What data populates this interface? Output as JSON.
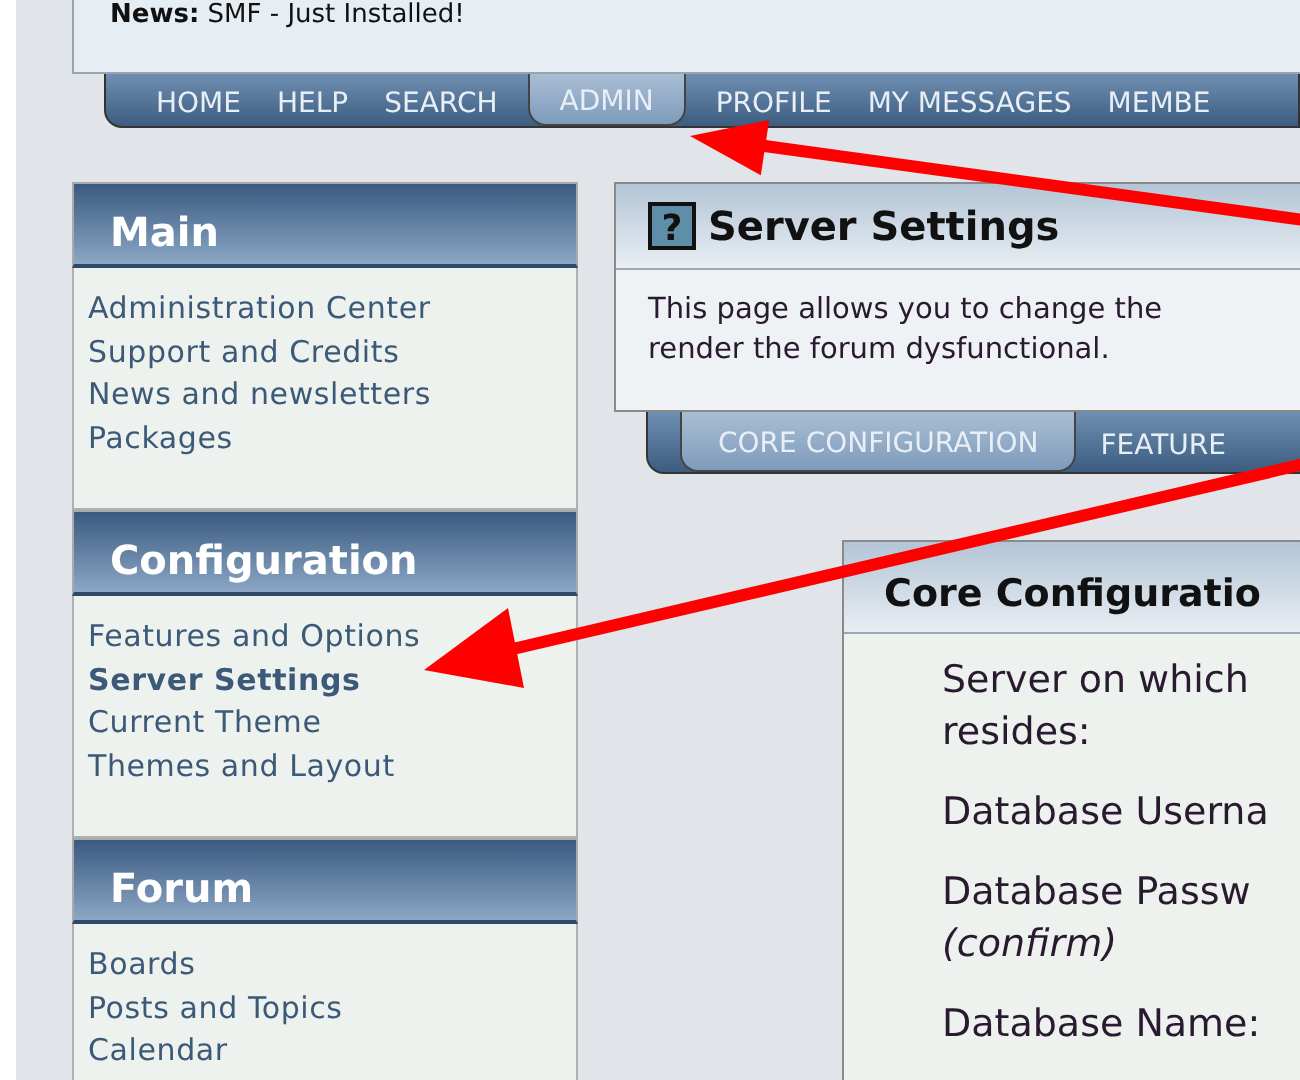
{
  "news": {
    "label": "News:",
    "text": "SMF - Just Installed!"
  },
  "menu": [
    {
      "label": "HOME",
      "selected": false
    },
    {
      "label": "HELP",
      "selected": false
    },
    {
      "label": "SEARCH",
      "selected": false
    },
    {
      "label": "ADMIN",
      "selected": true
    },
    {
      "label": "PROFILE",
      "selected": false
    },
    {
      "label": "MY MESSAGES",
      "selected": false
    },
    {
      "label": "MEMBE",
      "selected": false
    }
  ],
  "sidebar": [
    {
      "title": "Main",
      "items": [
        {
          "label": "Administration Center",
          "selected": false
        },
        {
          "label": "Support and Credits",
          "selected": false
        },
        {
          "label": "News and newsletters",
          "selected": false
        },
        {
          "label": "Packages",
          "selected": false
        }
      ]
    },
    {
      "title": "Configuration",
      "items": [
        {
          "label": "Features and Options",
          "selected": false
        },
        {
          "label": "Server Settings",
          "selected": true
        },
        {
          "label": "Current Theme",
          "selected": false
        },
        {
          "label": "Themes and Layout",
          "selected": false
        }
      ]
    },
    {
      "title": "Forum",
      "items": [
        {
          "label": "Boards",
          "selected": false
        },
        {
          "label": "Posts and Topics",
          "selected": false
        },
        {
          "label": "Calendar",
          "selected": false
        }
      ]
    }
  ],
  "page": {
    "icon": "?",
    "title": "Server Settings",
    "description": [
      "This page allows you to change the",
      "render the forum dysfunctional."
    ]
  },
  "tabs": [
    {
      "label": "CORE CONFIGURATION",
      "selected": true
    },
    {
      "label": "FEATURE",
      "selected": false
    }
  ],
  "section": {
    "title": "Core Configuratio",
    "fields": [
      {
        "lines": [
          "Server on which",
          "resides:"
        ]
      },
      {
        "lines": [
          "Database Userna"
        ]
      },
      {
        "lines": [
          "Database Passw"
        ],
        "note": "(confirm)"
      },
      {
        "lines": [
          "Database Name:"
        ]
      }
    ]
  }
}
